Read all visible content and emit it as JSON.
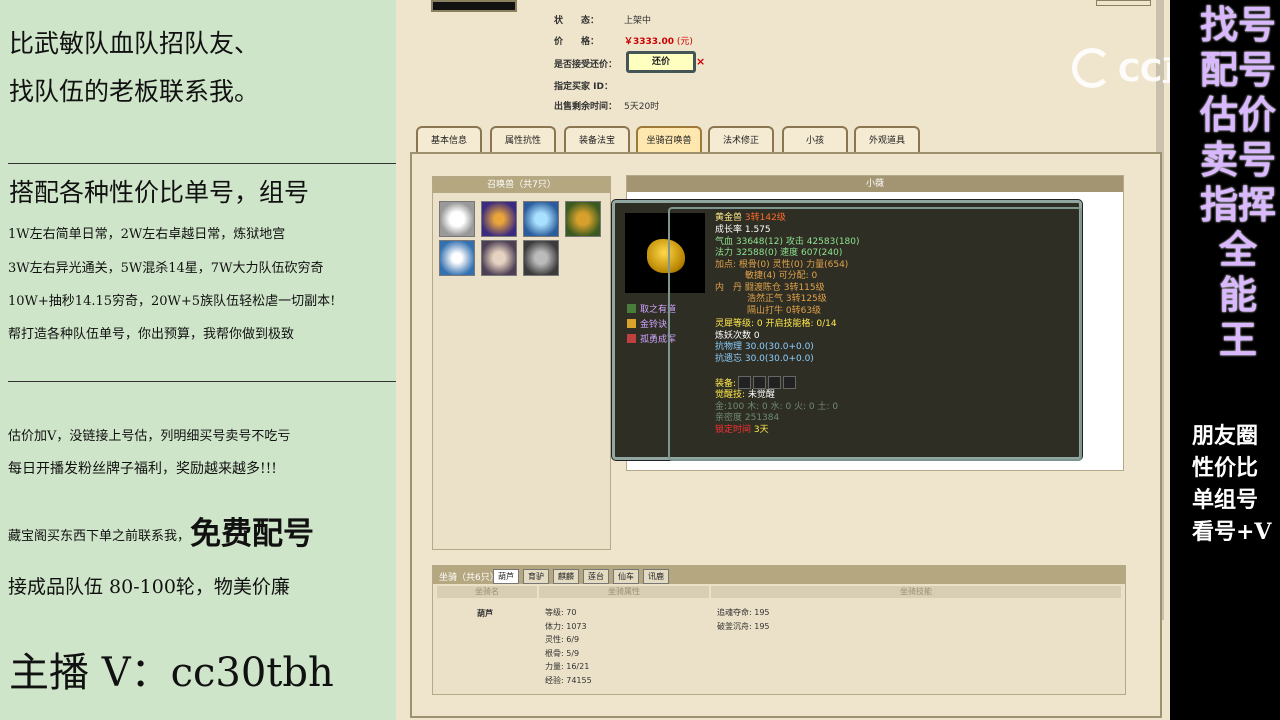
{
  "left_panel": {
    "line1": "比武敏队血队招队友、",
    "line2": "找队伍的老板联系我。",
    "line3": "搭配各种性价比单号，组号",
    "line4": "1W左右简单日常，2W左右卓越日常，炼狱地宫",
    "line5": "3W左右异光通关，5W混杀14星，7W大力队伍砍穷奇",
    "line6": "10W+抽秒14.15穷奇，20W+5族队伍轻松虐一切副本!",
    "line7": "帮打造各种队伍单号，你出预算，我帮你做到极致",
    "line8": "估价加V，没链接上号估，列明细买号卖号不吃亏",
    "line9": "每日开播发粉丝牌子福利，奖励越来越多!!!",
    "line10a": "藏宝阁买东西下单之前联系我，",
    "line10b": "免费配号",
    "line11": "接成品队伍 80-100轮，物美价廉",
    "line12": "主播 V：cc30tbh"
  },
  "right_panel": {
    "vertical": [
      "找号",
      "配号",
      "估价",
      "卖号",
      "指挥",
      "全",
      "能",
      "王"
    ],
    "small": [
      "朋友圈",
      "性价比",
      "单组号",
      "看号+V"
    ]
  },
  "watermark": {
    "text": "CC直播"
  },
  "listing": {
    "status_label": "状　　态：",
    "status_value": "上架中",
    "price_label": "价　　格：",
    "price_value": "￥3333.00",
    "price_unit": "(元)",
    "haggle_label": "是否接受还价：",
    "haggle_button": "还价",
    "close_x": "×",
    "buyer_label": "指定买家 ID：",
    "remain_label": "出售剩余时间：",
    "remain_value": "5天20时"
  },
  "tabs": [
    "基本信息",
    "属性抗性",
    "装备法宝",
    "坐骑召唤兽",
    "法术修正",
    "小孩",
    "外观道具"
  ],
  "pet_list": {
    "header": "召唤兽（共7只）"
  },
  "detail": {
    "header": "小薇"
  },
  "tooltip": {
    "name_label": "黄金兽",
    "level": "3转142级",
    "growth": "成长率 1.575",
    "hp": "气血 33648(12) 攻击 42583(180)",
    "mp": "法力 32588(0) 速度 607(240)",
    "points": "加点: 根骨(0) 灵性(0) 力量(654)",
    "points2": "敏捷(4) 可分配: 0",
    "inner1": "内　丹 闘渡陈仓 3转115级",
    "inner2": "浩然正气 3转125级",
    "inner3": "隔山打牛 0转63级",
    "skills": [
      "取之有道",
      "金铃诀",
      "孤勇成军"
    ],
    "spirit": "灵犀等级: 0 开启技能格: 0/14",
    "refine": "炼妖次数 0",
    "resist1": "抗物理 30.0(30.0+0.0)",
    "resist2": "抗遗忘 30.0(30.0+0.0)",
    "equip": "装备:",
    "awaken_label": "觉醒技:",
    "awaken_value": "未觉醒",
    "elements": "金:100 木: 0 水: 0 火: 0 土: 0",
    "intimacy": "亲密度 251384",
    "lock_label": "锁定时间",
    "lock_value": "3天"
  },
  "mount": {
    "header": "坐骑（共6只）",
    "tabs": [
      "葫芦",
      "育驴",
      "麒麟",
      "莲台",
      "仙车",
      "讯鹿"
    ],
    "col1": "坐骑名",
    "col2": "坐骑属性",
    "col3": "坐骑技能",
    "name": "葫芦",
    "stats": [
      "等级: 70",
      "体力: 1073",
      "灵性: 6/9",
      "根骨: 5/9",
      "力量: 16/21",
      "经验: 74155"
    ],
    "skills": [
      "追魂夺命: 195",
      "破釜沉舟: 195"
    ]
  }
}
